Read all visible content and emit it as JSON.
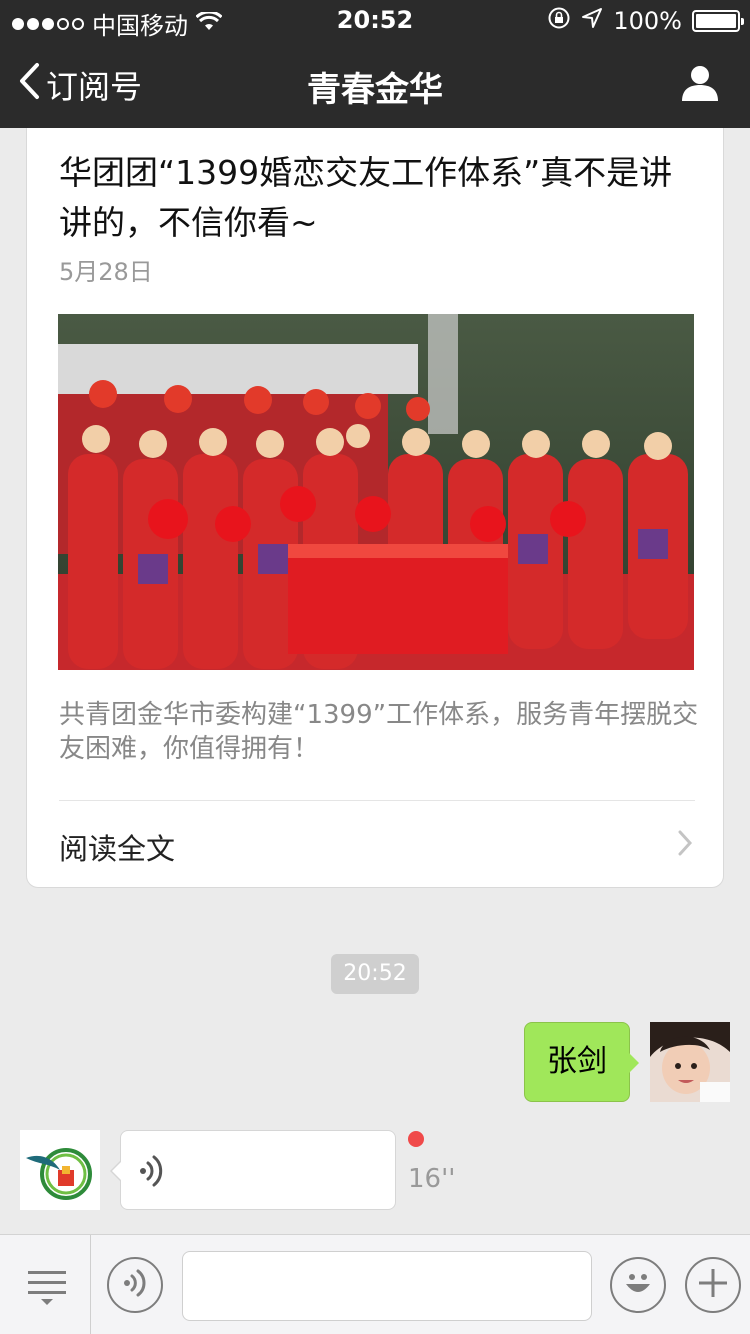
{
  "statusbar": {
    "carrier": "中国移动",
    "time": "20:52",
    "battery": "100%"
  },
  "nav": {
    "back_label": "订阅号",
    "title": "青春金华"
  },
  "article": {
    "headline": "华团团“1399婚恋交友工作体系”真不是讲讲的，不信你看~",
    "date": "5月28日",
    "summary": "共青团金华市委构建“1399”工作体系，服务青年摆脱交友困难，你值得拥有！",
    "read_more": "阅读全文"
  },
  "chat": {
    "timestamp": "20:52",
    "outgoing_text": "张剑",
    "voice_duration": "16''"
  },
  "colors": {
    "bar": "#2b2b2b",
    "outgoing_bubble": "#a0e75a",
    "unread": "#f04a4a",
    "background": "#ebebeb"
  },
  "icons": {
    "back": "chevron-left-icon",
    "profile": "user-icon",
    "wifi": "wifi-icon",
    "lock_rotation": "rotation-lock-icon",
    "location": "location-arrow-icon",
    "voice": "voice-wave-icon",
    "menu": "menu-icon",
    "emoji": "smiley-icon",
    "plus": "plus-icon"
  }
}
